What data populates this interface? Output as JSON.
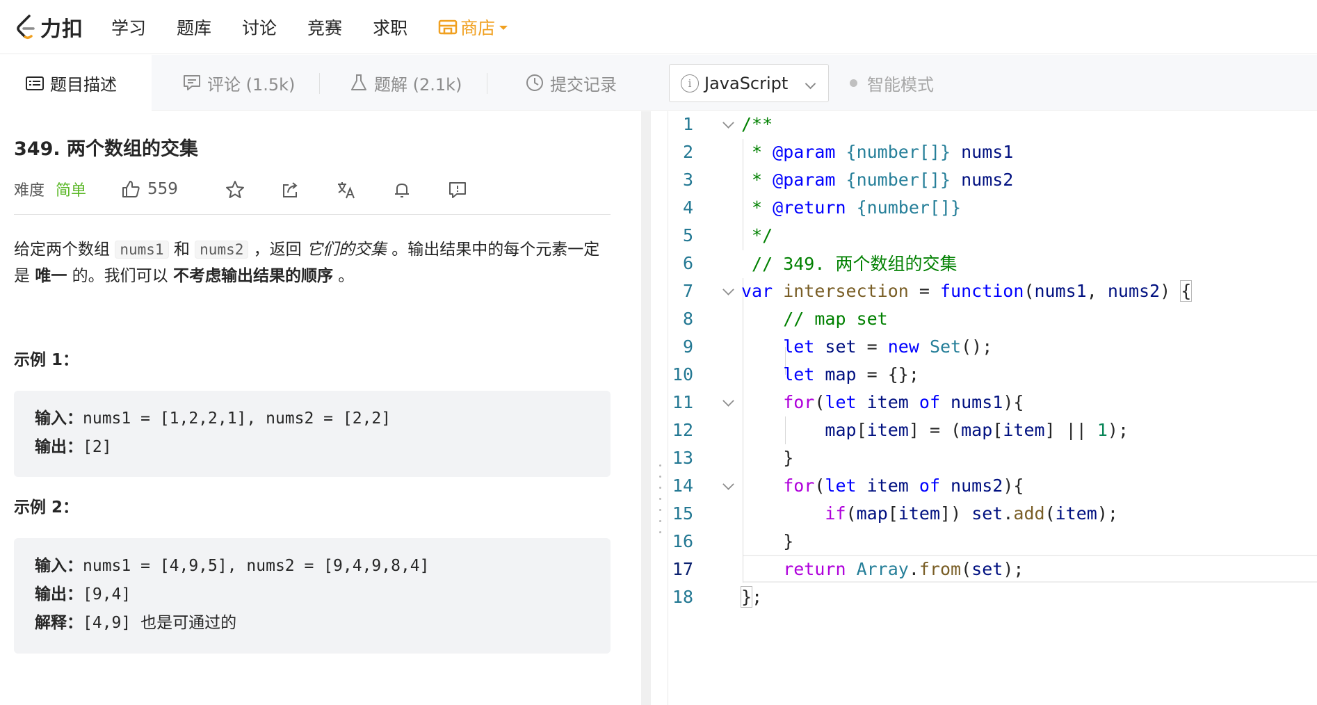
{
  "nav": {
    "logo_text": "力扣",
    "items": [
      "学习",
      "题库",
      "讨论",
      "竞赛",
      "求职"
    ],
    "store_label": "商店"
  },
  "tabs": {
    "description": "题目描述",
    "comments": "评论 (1.5k)",
    "solutions": "题解 (2.1k)",
    "submissions": "提交记录"
  },
  "editor_toolbar": {
    "language": "JavaScript",
    "smart_mode": "智能模式"
  },
  "problem": {
    "title": "349. 两个数组的交集",
    "difficulty_label": "难度",
    "difficulty_value": "简单",
    "likes": "559",
    "desc_pre": "给定两个数组 ",
    "code1": "nums1",
    "desc_and": " 和 ",
    "code2": "nums2",
    "desc_return": " ，返回 ",
    "desc_italic": "它们的交集",
    "desc_mid": " 。输出结果中的每个元素一定是 ",
    "desc_bold1": "唯一",
    "desc_mid2": " 的。我们可以 ",
    "desc_bold2": "不考虑输出结果的顺序",
    "desc_end": " 。",
    "examples": [
      {
        "title": "示例 1：",
        "input_label": "输入：",
        "input": "nums1 = [1,2,2,1], nums2 = [2,2]",
        "output_label": "输出：",
        "output": "[2]"
      },
      {
        "title": "示例 2：",
        "input_label": "输入：",
        "input": "nums1 = [4,9,5], nums2 = [9,4,9,8,4]",
        "output_label": "输出：",
        "output": "[9,4]",
        "explain_label": "解释：",
        "explain": "[4,9] 也是可通过的"
      }
    ]
  },
  "code": {
    "line_numbers": [
      "1",
      "2",
      "3",
      "4",
      "5",
      "6",
      "7",
      "8",
      "9",
      "10",
      "11",
      "12",
      "13",
      "14",
      "15",
      "16",
      "17",
      "18"
    ],
    "l1": "/**",
    "l2_star": " * ",
    "l2_tag": "@param",
    "l2_type": " {number[]}",
    "l2_name": " nums1",
    "l3_star": " * ",
    "l3_tag": "@param",
    "l3_type": " {number[]}",
    "l3_name": " nums2",
    "l4_star": " * ",
    "l4_tag": "@return",
    "l4_type": " {number[]}",
    "l5": " */",
    "l6": " // 349. 两个数组的交集",
    "l7_var": "var",
    "l7_name": " intersection",
    "l7_eq": " = ",
    "l7_fn": "function",
    "l7_p1": "(",
    "l7_a1": "nums1",
    "l7_c": ", ",
    "l7_a2": "nums2",
    "l7_p2": ") ",
    "l7_br": "{",
    "l8": "    // map set",
    "l9_let": "    let",
    "l9_set": " set",
    "l9_eq": " = ",
    "l9_new": "new",
    "l9_cls": " Set",
    "l9_end": "();",
    "l10_let": "    let",
    "l10_map": " map",
    "l10_end": " = {};",
    "l11_for": "    for",
    "l11_p": "(",
    "l11_let": "let",
    "l11_item": " item",
    "l11_of": " of",
    "l11_arr": " nums1",
    "l11_end": "){",
    "l12_sp": "        ",
    "l12_map": "map",
    "l12_b1": "[",
    "l12_item": "item",
    "l12_mid": "] = (",
    "l12_map2": "map",
    "l12_b2": "[",
    "l12_item2": "item",
    "l12_or": "] || ",
    "l12_num": "1",
    "l12_end": ");",
    "l13": "    }",
    "l14_for": "    for",
    "l14_p": "(",
    "l14_let": "let",
    "l14_item": " item",
    "l14_of": " of",
    "l14_arr": " nums2",
    "l14_end": "){",
    "l15_sp": "        ",
    "l15_if": "if",
    "l15_p": "(",
    "l15_map": "map",
    "l15_b": "[",
    "l15_item": "item",
    "l15_c": "]) ",
    "l15_set": "set",
    "l15_dot": ".",
    "l15_add": "add",
    "l15_p2": "(",
    "l15_item2": "item",
    "l15_end": ");",
    "l16": "    }",
    "l17_ret": "    return",
    "l17_cls": " Array",
    "l17_dot": ".",
    "l17_from": "from",
    "l17_p": "(",
    "l17_set": "set",
    "l17_end": ");",
    "l18_br": "}",
    "l18_end": ";"
  }
}
